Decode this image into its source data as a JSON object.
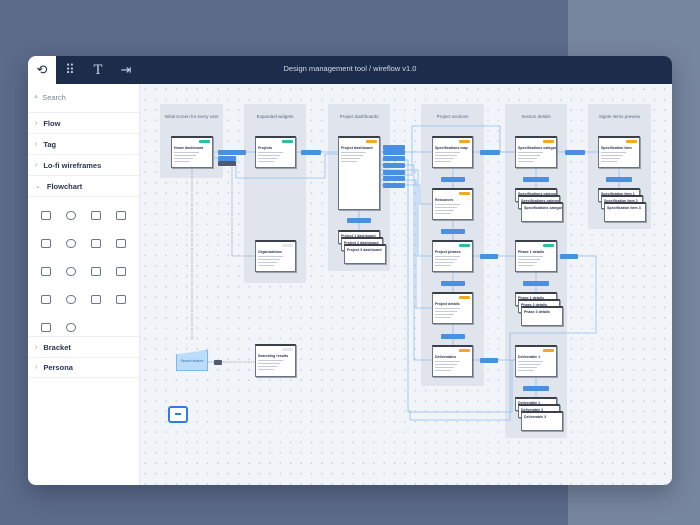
{
  "header": {
    "title": "Design management tool / wireflow v1.0",
    "tabs": [
      {
        "icon": "wireflow-logo-icon",
        "active": true
      },
      {
        "icon": "grid-icon"
      },
      {
        "icon": "text-icon"
      },
      {
        "icon": "export-icon"
      }
    ]
  },
  "sidebar": {
    "search_placeholder": "Search",
    "items": [
      {
        "label": "Flow",
        "expanded": false
      },
      {
        "label": "Tag",
        "expanded": false
      },
      {
        "label": "Lo-fi wireframes",
        "expanded": false
      },
      {
        "label": "Flowchart",
        "expanded": true
      }
    ],
    "bottom_items": [
      {
        "label": "Bracket"
      },
      {
        "label": "Persona"
      }
    ],
    "flowchart_shapes": 18
  },
  "colors": {
    "header": "#1c2d4b",
    "connector": "#4a90e2",
    "badge_teal": "#2bbf9f",
    "badge_orange": "#f5a623"
  },
  "canvas": {
    "columns": [
      "Initial screen for every user",
      "Expanded widgets",
      "Project dashboards",
      "Project sections",
      "Section details",
      "Signle items preview"
    ],
    "cards": [
      {
        "title": "Home dashboard",
        "badge": "teal"
      },
      {
        "title": "Projects",
        "badge": "teal"
      },
      {
        "title": "Organizations",
        "badge": "none"
      },
      {
        "title": "Project dashboard",
        "badge": "orange"
      },
      {
        "title": "Specifications map",
        "badge": "orange"
      },
      {
        "title": "Resources",
        "badge": "orange"
      },
      {
        "title": "Project phases",
        "badge": "teal"
      },
      {
        "title": "Project details",
        "badge": "orange"
      },
      {
        "title": "Deliverables",
        "badge": "orange"
      },
      {
        "title": "Specifications category",
        "badge": "orange"
      },
      {
        "title": "Phase 1 details",
        "badge": "teal"
      },
      {
        "title": "Deliverable 1",
        "badge": "orange"
      },
      {
        "title": "Specification item",
        "badge": "orange"
      },
      {
        "title": "Searching results",
        "badge": "none"
      }
    ],
    "stacks": [
      [
        "Project 1 dashboard",
        "Project 2 dashboard",
        "Project 3 dashboard"
      ],
      [
        "Specifications category 1",
        "Specifications category 2",
        "Specifications category 3"
      ],
      [
        "Phase 1 details",
        "Phase 2 details",
        "Phase 3 details"
      ],
      [
        "Deliverable 1",
        "Deliverable 2",
        "Deliverable 3"
      ],
      [
        "Specification item 1",
        "Specification item 2",
        "Specification item 3"
      ]
    ],
    "search_feature": "Search feature"
  }
}
